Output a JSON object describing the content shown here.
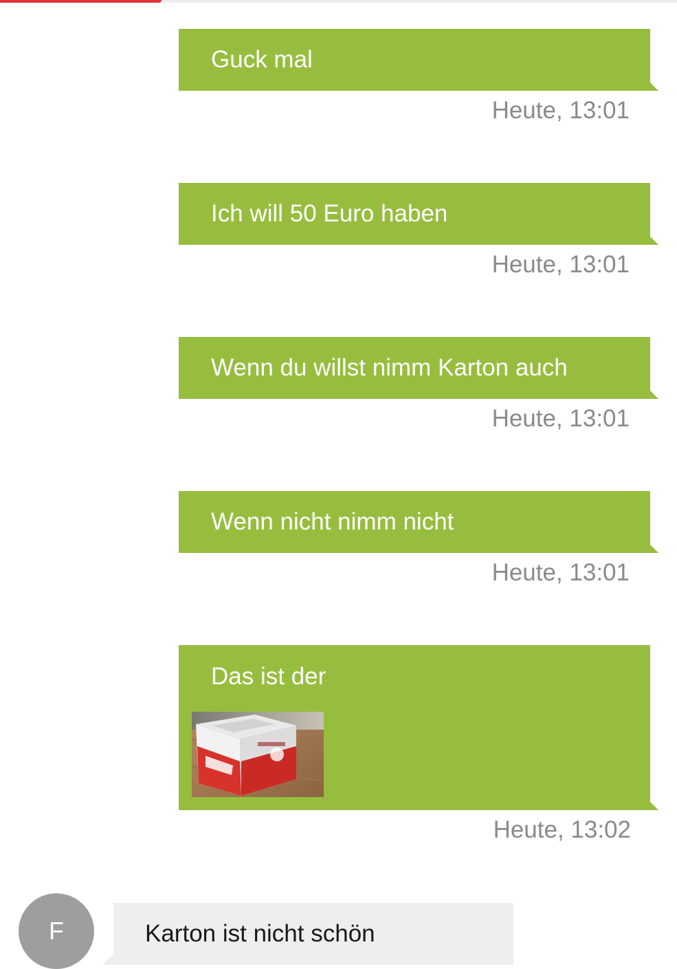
{
  "outgoing_messages": [
    {
      "text": "Guck mal",
      "time": "Heute, 13:01"
    },
    {
      "text": "Ich will 50 Euro haben",
      "time": "Heute, 13:01"
    },
    {
      "text": "Wenn du willst nimm Karton auch",
      "time": "Heute, 13:01"
    },
    {
      "text": "Wenn nicht nimm nicht",
      "time": "Heute, 13:01"
    },
    {
      "text": "Das ist der",
      "time": "Heute, 13:02",
      "attachment": "image-thumbnail"
    }
  ],
  "incoming_message": {
    "avatar_initial": "F",
    "text": "Karton ist nicht schön"
  },
  "colors": {
    "outgoing_bubble": "#97bd3f",
    "incoming_bubble": "#eeeeee",
    "avatar": "#9e9e9e",
    "timestamp": "#8a8a8a",
    "top_accent": "#e0343a"
  }
}
